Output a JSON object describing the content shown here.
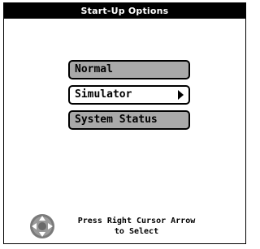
{
  "header": {
    "title": "Start-Up Options"
  },
  "menu": {
    "items": [
      {
        "label": "Normal",
        "selected": false
      },
      {
        "label": "Simulator",
        "selected": true
      },
      {
        "label": "System Status",
        "selected": false
      }
    ]
  },
  "footer": {
    "hint_line1": "Press Right Cursor Arrow",
    "hint_line2": "to Select",
    "icon": "cursor-pad-icon"
  },
  "colors": {
    "item_fill": "#a9a9a9",
    "selected_fill": "#ffffff",
    "title_bg": "#000000"
  }
}
